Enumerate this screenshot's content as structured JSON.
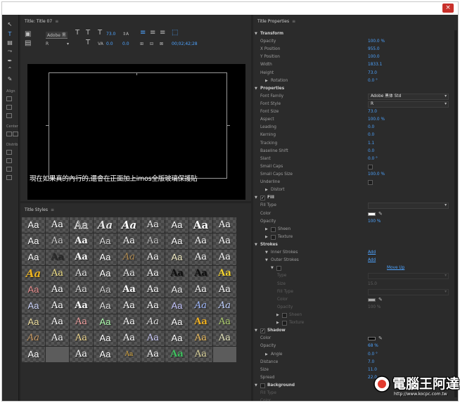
{
  "window": {
    "close_glyph": "×"
  },
  "toolstrip": {
    "tools": [
      "selection-tool-icon",
      "type-tool-icon",
      "vertical-type-tool-icon",
      "area-type-tool-icon",
      "path-type-tool-icon",
      "pen-tool-icon",
      "add-anchor-icon",
      "convert-anchor-icon"
    ],
    "labels": {
      "align": "Align",
      "center": "Center",
      "distribute": "Distrib"
    }
  },
  "editor": {
    "tab_label": "Title: Title 07",
    "menu_glyph": "≡",
    "toolbar": {
      "font_family": "Adobe 黑",
      "font_style": "R",
      "font_size": "73.0",
      "kerning": "0.0",
      "leading": "0.0",
      "timecode": "00;02;42;28"
    },
    "subtitle": "現在如果真的內行的,還會在正面加上imos全版玻璃保護貼"
  },
  "title_styles": {
    "tab_label": "Title Styles",
    "sample": "Aa",
    "cells": [
      {
        "c": "#ffffff",
        "s": "plain"
      },
      {
        "c": "#ffffff",
        "s": "serif"
      },
      {
        "c": "#dddddd",
        "s": "outline"
      },
      {
        "c": "#e0e0e0",
        "s": "italic-big"
      },
      {
        "c": "#ffffff",
        "s": "italic-big"
      },
      {
        "c": "#f0f0f0",
        "s": "plain"
      },
      {
        "c": "#ffffff",
        "s": "plain"
      },
      {
        "c": "#ffffff",
        "s": "wide"
      },
      {
        "c": "#ffffff",
        "s": "plain"
      },
      {
        "c": "#ffffff",
        "s": "plain"
      },
      {
        "c": "#cccccc",
        "s": "plain"
      },
      {
        "c": "#ffffff",
        "s": "bold"
      },
      {
        "c": "#d8d8d8",
        "s": "plain"
      },
      {
        "c": "#ffffff",
        "s": "plain"
      },
      {
        "c": "#c8c8c8",
        "s": "plain"
      },
      {
        "c": "#ffffff",
        "s": "plain"
      },
      {
        "c": "#ffffff",
        "s": "plain"
      },
      {
        "c": "#ffffff",
        "s": "plain"
      },
      {
        "c": "#ffffff",
        "s": "plain"
      },
      {
        "c": "#2a2a2a",
        "s": "bold"
      },
      {
        "c": "#ffffff",
        "s": "bold"
      },
      {
        "c": "#ffffff",
        "s": "plain"
      },
      {
        "c": "#b08a50",
        "s": "italic"
      },
      {
        "c": "#ffffff",
        "s": "plain"
      },
      {
        "c": "#f5efc8",
        "s": "plain"
      },
      {
        "c": "#ffffff",
        "s": "plain"
      },
      {
        "c": "#ffffff",
        "s": "plain"
      },
      {
        "c": "#e8b020",
        "s": "italic-big"
      },
      {
        "c": "#f4e48a",
        "s": "plain"
      },
      {
        "c": "#e8e8e8",
        "s": "plain"
      },
      {
        "c": "#ffffff",
        "s": "plain"
      },
      {
        "c": "#f0f0f0",
        "s": "plain"
      },
      {
        "c": "#ffffff",
        "s": "plain"
      },
      {
        "c": "#111111",
        "s": "bold"
      },
      {
        "c": "#111111",
        "s": "bold"
      },
      {
        "c": "#f2d230",
        "s": "bold"
      },
      {
        "c": "#e89090",
        "s": "plain"
      },
      {
        "c": "#ffffff",
        "s": "plain"
      },
      {
        "c": "#e0e0e0",
        "s": "plain"
      },
      {
        "c": "#d0d0d0",
        "s": "plain"
      },
      {
        "c": "#ffffff",
        "s": "bold"
      },
      {
        "c": "#ffffff",
        "s": "plain"
      },
      {
        "c": "#f0f0f0",
        "s": "plain"
      },
      {
        "c": "#ffffff",
        "s": "plain"
      },
      {
        "c": "#ffffff",
        "s": "plain"
      },
      {
        "c": "#cfd8ff",
        "s": "plain"
      },
      {
        "c": "#ffffff",
        "s": "plain"
      },
      {
        "c": "#ffffff",
        "s": "bold"
      },
      {
        "c": "#e0e0e0",
        "s": "plain"
      },
      {
        "c": "#ffffff",
        "s": "plain"
      },
      {
        "c": "#ffffff",
        "s": "plain"
      },
      {
        "c": "#c8c8ff",
        "s": "plain"
      },
      {
        "c": "#9fb8ff",
        "s": "italic"
      },
      {
        "c": "#bfd0ff",
        "s": "italic"
      },
      {
        "c": "#f0e0a0",
        "s": "plain"
      },
      {
        "c": "#ffffff",
        "s": "plain"
      },
      {
        "c": "#f0a0a0",
        "s": "plain"
      },
      {
        "c": "#b0ffb0",
        "s": "plain"
      },
      {
        "c": "#ffffff",
        "s": "plain"
      },
      {
        "c": "#e0e0e0",
        "s": "italic"
      },
      {
        "c": "#ffffff",
        "s": "plain"
      },
      {
        "c": "#f0b020",
        "s": "bold"
      },
      {
        "c": "#b0d070",
        "s": "plain"
      },
      {
        "c": "#c89860",
        "s": "italic"
      },
      {
        "c": "#f0f0f0",
        "s": "plain"
      },
      {
        "c": "#f0d890",
        "s": "plain"
      },
      {
        "c": "#ffffff",
        "s": "plain"
      },
      {
        "c": "#ffffff",
        "s": "plain"
      },
      {
        "c": "#d0d0ff",
        "s": "plain"
      },
      {
        "c": "#ffffff",
        "s": "plain"
      },
      {
        "c": "#f0c060",
        "s": "plain"
      },
      {
        "c": "#e8e8c0",
        "s": "plain"
      },
      {
        "c": "#ffffff",
        "s": "plain"
      },
      {
        "c": "",
        "s": "empty"
      },
      {
        "c": "#ffffff",
        "s": "plain"
      },
      {
        "c": "#ffffff",
        "s": "plain"
      },
      {
        "c": "#d8a840",
        "s": "small"
      },
      {
        "c": "#ffffff",
        "s": "plain"
      },
      {
        "c": "#40c060",
        "s": "bold"
      },
      {
        "c": "#e0d8a0",
        "s": "plain"
      },
      {
        "c": "",
        "s": "empty"
      }
    ]
  },
  "properties": {
    "tab_label": "Title Properties",
    "rows": [
      {
        "t": "section",
        "label": "Transform",
        "indent": 0,
        "arrow": "▼"
      },
      {
        "t": "value",
        "label": "Opacity",
        "value": "100.0 %"
      },
      {
        "t": "value",
        "label": "X Position",
        "value": "955.0"
      },
      {
        "t": "value",
        "label": "Y Position",
        "value": "100.0"
      },
      {
        "t": "value",
        "label": "Width",
        "value": "1833.1"
      },
      {
        "t": "value",
        "label": "Height",
        "value": "73.0"
      },
      {
        "t": "value",
        "label": "Rotation",
        "value": "0.0 °",
        "arrow": "▶",
        "indent": 1
      },
      {
        "t": "section",
        "label": "Properties",
        "indent": 0,
        "arrow": "▼"
      },
      {
        "t": "dropdown",
        "label": "Font Family",
        "value": "Adobe 黑体 Std"
      },
      {
        "t": "dropdown",
        "label": "Font Style",
        "value": "R"
      },
      {
        "t": "value",
        "label": "Font Size",
        "value": "73.0"
      },
      {
        "t": "value",
        "label": "Aspect",
        "value": "100.0 %"
      },
      {
        "t": "value",
        "label": "Leading",
        "value": "0.0"
      },
      {
        "t": "value",
        "label": "Kerning",
        "value": "0.0"
      },
      {
        "t": "value",
        "label": "Tracking",
        "value": "1.1"
      },
      {
        "t": "value",
        "label": "Baseline Shift",
        "value": "0.0"
      },
      {
        "t": "value",
        "label": "Slant",
        "value": "0.0 °"
      },
      {
        "t": "check",
        "label": "Small Caps"
      },
      {
        "t": "value",
        "label": "Small Caps Size",
        "value": "100.0 %"
      },
      {
        "t": "check",
        "label": "Underline"
      },
      {
        "t": "sub",
        "label": "Distort",
        "arrow": "▶",
        "indent": 1
      },
      {
        "t": "checksection",
        "label": "Fill",
        "arrow": "▼",
        "checked": true
      },
      {
        "t": "dropdown",
        "label": "Fill Type",
        "value": ""
      },
      {
        "t": "color",
        "label": "Color",
        "swatch": "#ffffff"
      },
      {
        "t": "value",
        "label": "Opacity",
        "value": "100 %"
      },
      {
        "t": "subcheck",
        "label": "Sheen",
        "arrow": "▶",
        "indent": 1
      },
      {
        "t": "subcheck",
        "label": "Texture",
        "arrow": "▶",
        "indent": 1
      },
      {
        "t": "section",
        "label": "Strokes",
        "indent": 0,
        "arrow": "▼"
      },
      {
        "t": "link",
        "label": "Inner Strokes",
        "value": "Add",
        "arrow": "▼",
        "indent": 1
      },
      {
        "t": "link",
        "label": "Outer Strokes",
        "value": "Add",
        "arrow": "▼",
        "indent": 1
      },
      {
        "t": "strokecheck",
        "label": "",
        "value": "Move Up",
        "arrow": "▼",
        "indent": 2
      },
      {
        "t": "dimdropdown",
        "label": "Type",
        "indent": 3
      },
      {
        "t": "dim",
        "label": "Size",
        "value": "15.0",
        "indent": 3
      },
      {
        "t": "dimdropdown",
        "label": "Fill Type",
        "indent": 3
      },
      {
        "t": "dimcolor",
        "label": "Color",
        "swatch": "#ffffff",
        "indent": 3
      },
      {
        "t": "dim",
        "label": "Opacity",
        "value": "100 %",
        "indent": 3
      },
      {
        "t": "dimsub",
        "label": "Sheen",
        "arrow": "▶",
        "indent": 3
      },
      {
        "t": "dimsub",
        "label": "Texture",
        "arrow": "▶",
        "indent": 3
      },
      {
        "t": "checksection",
        "label": "Shadow",
        "arrow": "▼",
        "checked": true
      },
      {
        "t": "color",
        "label": "Color",
        "swatch": "#000000"
      },
      {
        "t": "value",
        "label": "Opacity",
        "value": "68 %"
      },
      {
        "t": "value",
        "label": "Angle",
        "value": "0.0 °",
        "arrow": "▶",
        "indent": 1
      },
      {
        "t": "value",
        "label": "Distance",
        "value": "7.0"
      },
      {
        "t": "value",
        "label": "Size",
        "value": "11.0"
      },
      {
        "t": "value",
        "label": "Spread",
        "value": "22.0"
      },
      {
        "t": "checksection",
        "label": "Background",
        "arrow": "▼",
        "checked": false
      },
      {
        "t": "dim",
        "label": "Fill Type",
        "value": ""
      },
      {
        "t": "dim",
        "label": "Color",
        "value": ""
      }
    ]
  },
  "watermark": {
    "text": "電腦王阿達",
    "url": "http://www.kocpc.com.tw"
  }
}
